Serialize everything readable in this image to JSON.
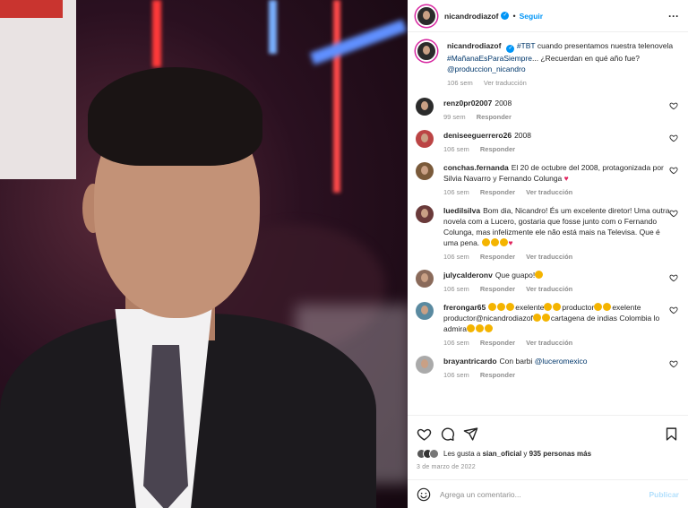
{
  "post": {
    "username": "nicandrodiazof",
    "follow_label": "Seguir",
    "dot": "•"
  },
  "caption": {
    "username": "nicandrodiazof",
    "hashtag1": "#TBT",
    "text1": "cuando presentamos nuestra telenovela",
    "hashtag2": "#MañanaEsParaSiempre",
    "text2": "... ¿Recuerdan en qué año fue?",
    "mention": "@produccion_nicandro",
    "time": "106 sem",
    "translate": "Ver traducción"
  },
  "comments": [
    {
      "user": "renz0pr02007",
      "text": "2008",
      "time": "99 sem",
      "reply": "Responder",
      "translate": ""
    },
    {
      "user": "deniseeguerrero26",
      "text": "2008",
      "time": "106 sem",
      "reply": "Responder",
      "translate": ""
    },
    {
      "user": "conchas.fernanda",
      "text": "El 20 de octubre del 2008, protagonizada por Silvia Navarro y Fernando Colunga",
      "time": "106 sem",
      "reply": "Responder",
      "translate": "Ver traducción"
    },
    {
      "user": "luedilsilva",
      "text": "Bom dia, Nicandro! És um excelente diretor! Uma outra novela com a Lucero, gostaria que fosse junto com o Fernando Colunga, mas infelizmente ele não está mais na Televisa. Que é uma pena.",
      "time": "106 sem",
      "reply": "Responder",
      "translate": "Ver traducción"
    },
    {
      "user": "julycalderonv",
      "text": "Que guapo!",
      "time": "106 sem",
      "reply": "Responder",
      "translate": "Ver traducción"
    },
    {
      "user": "frerongar65",
      "text_a": "exelente",
      "text_b": "productor",
      "text_c": "exelente productor@nicandrodiazof",
      "text_d": "cartagena de indias Colombia lo admira",
      "time": "106 sem",
      "reply": "Responder",
      "translate": "Ver traducción"
    },
    {
      "user": "brayantricardo",
      "text": "Con barbi",
      "mention": "@luceromexico",
      "time": "106 sem",
      "reply": "Responder",
      "translate": ""
    }
  ],
  "likes": {
    "prefix": "Les gusta a",
    "user": "sian_oficial",
    "joiner": "y",
    "others": "935 personas más"
  },
  "date": "3 de marzo de 2022",
  "add_comment": {
    "placeholder": "Agrega un comentario...",
    "publish_label": "Publicar"
  },
  "colors": {
    "accent": "#0095f6",
    "link": "#00376b",
    "muted": "#8e8e8e",
    "heart": "#e0245e"
  }
}
